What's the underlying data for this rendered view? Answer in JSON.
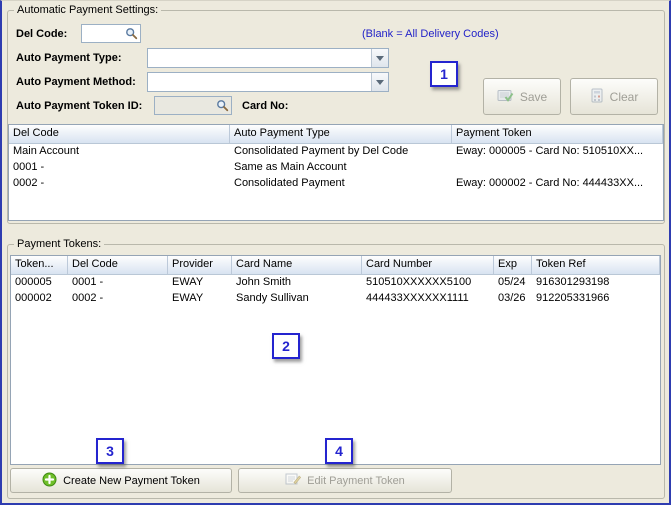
{
  "settings": {
    "title": "Automatic Payment Settings:",
    "del_code": {
      "label": "Del Code:",
      "value": ""
    },
    "blank_note": "(Blank = All Delivery Codes)",
    "auto_payment_type": {
      "label": "Auto Payment Type:",
      "value": ""
    },
    "auto_payment_method": {
      "label": "Auto Payment Method:",
      "value": ""
    },
    "auto_payment_token_id": {
      "label": "Auto Payment Token ID:",
      "value": ""
    },
    "card_no_label": "Card No:",
    "save_label": "Save",
    "clear_label": "Clear",
    "table": {
      "columns": [
        "Del Code",
        "Auto Payment Type",
        "Payment Token"
      ],
      "rows": [
        [
          "Main Account",
          "Consolidated Payment by Del Code",
          "Eway: 000005 - Card No: 510510XX..."
        ],
        [
          "0001 -",
          "Same as Main Account",
          ""
        ],
        [
          "0002 -",
          "Consolidated Payment",
          "Eway: 000002 - Card No: 444433XX..."
        ]
      ]
    }
  },
  "tokens": {
    "title": "Payment Tokens:",
    "table": {
      "columns": [
        "Token...",
        "Del Code",
        "Provider",
        "Card Name",
        "Card Number",
        "Exp",
        "Token Ref"
      ],
      "rows": [
        [
          "000005",
          "0001 -",
          "EWAY",
          "John Smith",
          "510510XXXXXX5100",
          "05/24",
          "916301293198"
        ],
        [
          "000002",
          "0002 -",
          "EWAY",
          "Sandy Sullivan",
          "444433XXXXXX1111",
          "03/26",
          "912205331966"
        ]
      ]
    },
    "create_button_label": "Create New Payment Token",
    "edit_button_label": "Edit Payment Token"
  },
  "callouts": {
    "c1": "1",
    "c2": "2",
    "c3": "3",
    "c4": "4"
  },
  "colors": {
    "accent_blue": "#2424cf",
    "note_blue": "#2323c8",
    "window_bg": "#edeadd"
  }
}
